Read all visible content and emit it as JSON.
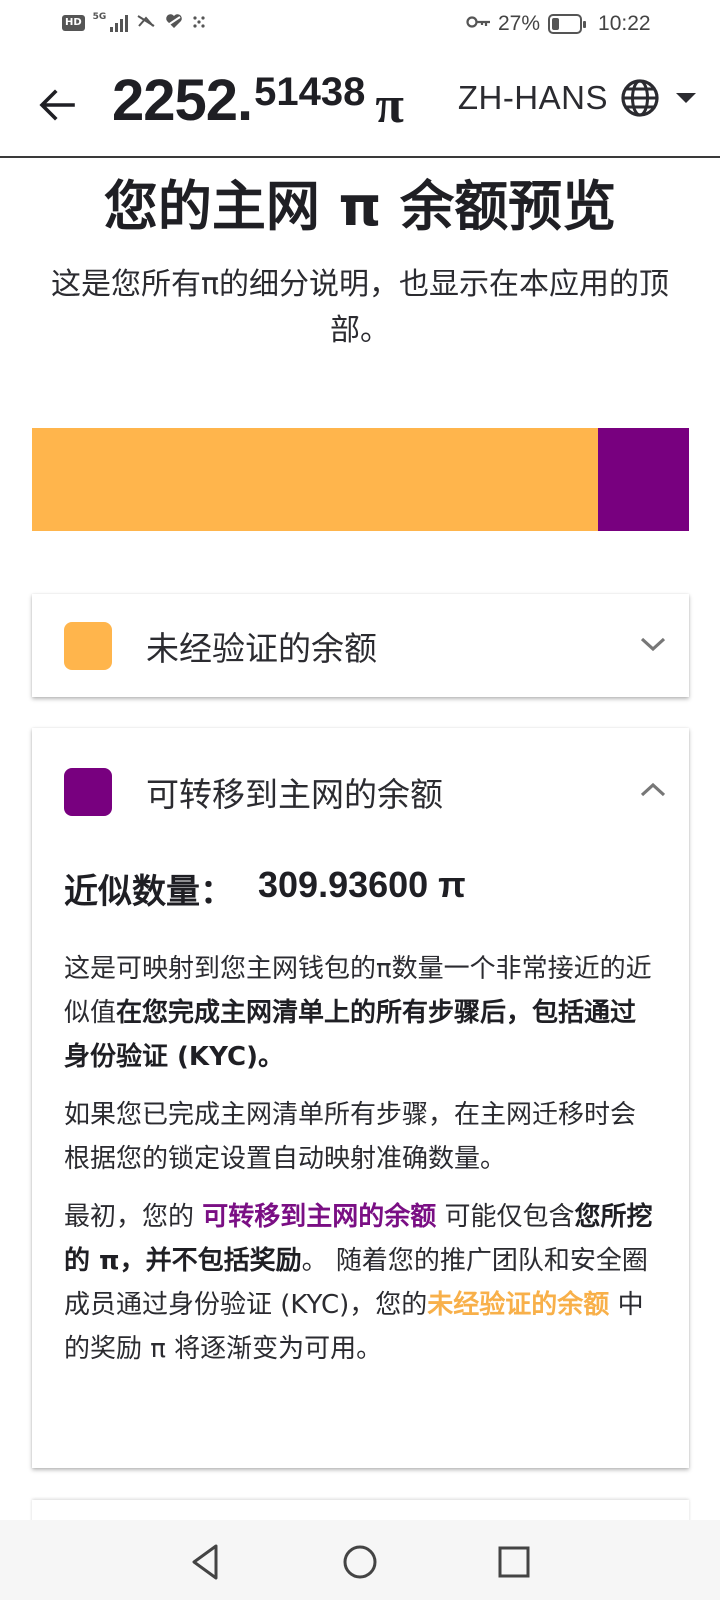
{
  "status": {
    "hd": "HD",
    "network": "5G",
    "battery_percent": "27%",
    "battery_level": 0.27,
    "time": "10:22"
  },
  "header": {
    "balance_int": "2252.",
    "balance_dec": "51438",
    "pi_symbol": "π",
    "language": "ZH-HANS"
  },
  "page": {
    "title": "您的主网 π 余额预览",
    "subtitle": "这是您所有π的细分说明，也显示在本应用的顶部。"
  },
  "breakdown_bar": {
    "segments": [
      {
        "name": "unverified",
        "fraction": 0.862,
        "color": "#ffb54c"
      },
      {
        "name": "transferable",
        "fraction": 0.138,
        "color": "#78007f"
      }
    ]
  },
  "cards": {
    "unverified": {
      "label": "未经验证的余额",
      "color": "#ffb54c",
      "expanded": false
    },
    "transferable": {
      "label": "可转移到主网的余额",
      "color": "#78007f",
      "expanded": true,
      "approx_label": "近似数量：",
      "approx_value": "309.93600 π",
      "p1_a": "这是可映射到您主网钱包的π数量一个非常接近的近似值",
      "p1_b": "在您完成主网清单上的所有步骤后，包括通过身份验证 (KYC)。",
      "p2": "如果您已完成主网清单所有步骤，在主网迁移时会根据您的锁定设置自动映射准确数量。",
      "p3_a": "最初，您的 ",
      "p3_b": "可转移到主网的余额",
      "p3_c": " 可能仅包含",
      "p3_d": "您所挖的 π，并不包括奖励",
      "p3_e": "。 随着您的推广团队和安全圈成员通过身份验证 (KYC)，您的",
      "p3_f": "未经验证的余额",
      "p3_g": " 中的奖励 π 将逐渐变为可用。"
    }
  },
  "icons": {
    "back": "arrow-left-icon",
    "language": "globe-icon",
    "caret": "caret-down-icon",
    "chevron_down": "chevron-down-icon",
    "chevron_up": "chevron-up-icon"
  }
}
